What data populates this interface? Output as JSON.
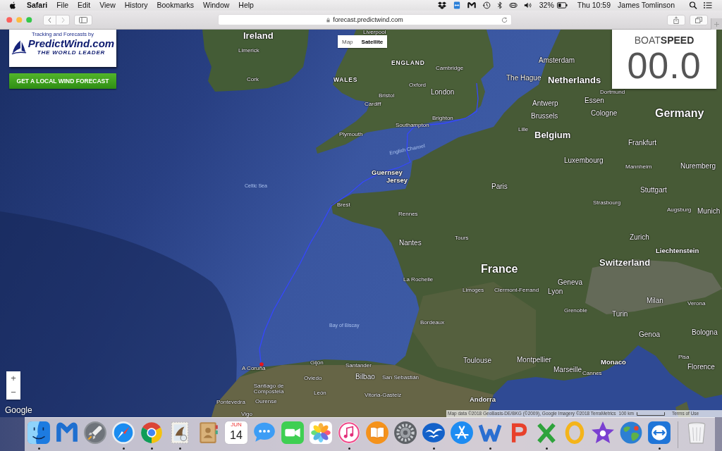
{
  "menu_bar": {
    "app_name": "Safari",
    "menus": [
      "File",
      "Edit",
      "View",
      "History",
      "Bookmarks",
      "Window",
      "Help"
    ],
    "battery": "32%",
    "clock": "Thu 10:59",
    "user": "James Tomlinson"
  },
  "toolbar": {
    "url": "forecast.predictwind.com"
  },
  "map": {
    "logo": {
      "tagline": "Tracking and Forecasts by",
      "name": "PredictWind.com",
      "slogan": "THE WORLD LEADER"
    },
    "forecast_button": "GET A LOCAL WIND FORECAST",
    "map_types": [
      {
        "label": "Map",
        "selected": false
      },
      {
        "label": "Satellite",
        "selected": true
      }
    ],
    "boatspeed": {
      "title": "BOAT**SPEED**",
      "value": "00.0"
    },
    "labels": [
      {
        "text": "Ireland",
        "kind": "country"
      },
      {
        "text": "Liverpool",
        "kind": "city"
      },
      {
        "text": "Limerick",
        "kind": "city"
      },
      {
        "text": "Cork",
        "kind": "city"
      },
      {
        "text": "WALES",
        "kind": "region"
      },
      {
        "text": "ENGLAND",
        "kind": "region"
      },
      {
        "text": "Cambridge",
        "kind": "city"
      },
      {
        "text": "Oxford",
        "kind": "city"
      },
      {
        "text": "London",
        "kind": "major_city"
      },
      {
        "text": "Bristol",
        "kind": "city"
      },
      {
        "text": "Cardiff",
        "kind": "city"
      },
      {
        "text": "Plymouth",
        "kind": "city"
      },
      {
        "text": "Brighton",
        "kind": "city"
      },
      {
        "text": "Southampton",
        "kind": "city"
      },
      {
        "text": "English Channel",
        "kind": "sea"
      },
      {
        "text": "Celtic Sea",
        "kind": "sea"
      },
      {
        "text": "Guernsey",
        "kind": "island"
      },
      {
        "text": "Jersey",
        "kind": "island"
      },
      {
        "text": "Brest",
        "kind": "city"
      },
      {
        "text": "Rennes",
        "kind": "city"
      },
      {
        "text": "Nantes",
        "kind": "major_city"
      },
      {
        "text": "Tours",
        "kind": "city"
      },
      {
        "text": "Paris",
        "kind": "major_city"
      },
      {
        "text": "France",
        "kind": "large_country"
      },
      {
        "text": "La Rochelle",
        "kind": "city"
      },
      {
        "text": "Limoges",
        "kind": "city"
      },
      {
        "text": "Clermont-Ferrand",
        "kind": "city"
      },
      {
        "text": "Lyon",
        "kind": "major_city"
      },
      {
        "text": "Bay of Biscay",
        "kind": "sea"
      },
      {
        "text": "Bordeaux",
        "kind": "city"
      },
      {
        "text": "Amsterdam",
        "kind": "major_city"
      },
      {
        "text": "The Hague",
        "kind": "major_city"
      },
      {
        "text": "Netherlands",
        "kind": "country"
      },
      {
        "text": "Antwerp",
        "kind": "major_city"
      },
      {
        "text": "Essen",
        "kind": "major_city"
      },
      {
        "text": "Dortmund",
        "kind": "city"
      },
      {
        "text": "Brussels",
        "kind": "major_city"
      },
      {
        "text": "Cologne",
        "kind": "major_city"
      },
      {
        "text": "Lille",
        "kind": "city"
      },
      {
        "text": "Belgium",
        "kind": "country"
      },
      {
        "text": "Germany",
        "kind": "large_country"
      },
      {
        "text": "Frankfurt",
        "kind": "major_city"
      },
      {
        "text": "Luxembourg",
        "kind": "major_city"
      },
      {
        "text": "Mannheim",
        "kind": "city"
      },
      {
        "text": "Nuremberg",
        "kind": "major_city"
      },
      {
        "text": "Stuttgart",
        "kind": "major_city"
      },
      {
        "text": "Strasbourg",
        "kind": "city"
      },
      {
        "text": "Augsburg",
        "kind": "city"
      },
      {
        "text": "Munich",
        "kind": "major_city"
      },
      {
        "text": "Zurich",
        "kind": "major_city"
      },
      {
        "text": "Liechtenstein",
        "kind": "minor_country"
      },
      {
        "text": "Switzerland",
        "kind": "country"
      },
      {
        "text": "Geneva",
        "kind": "major_city"
      },
      {
        "text": "Grenoble",
        "kind": "city"
      },
      {
        "text": "Milan",
        "kind": "major_city"
      },
      {
        "text": "Turin",
        "kind": "major_city"
      },
      {
        "text": "Verona",
        "kind": "city"
      },
      {
        "text": "Genoa",
        "kind": "major_city"
      },
      {
        "text": "Bologna",
        "kind": "major_city"
      },
      {
        "text": "Toulouse",
        "kind": "major_city"
      },
      {
        "text": "Montpellier",
        "kind": "major_city"
      },
      {
        "text": "Marseille",
        "kind": "major_city"
      },
      {
        "text": "Monaco",
        "kind": "minor_country"
      },
      {
        "text": "Cannes",
        "kind": "city"
      },
      {
        "text": "Pisa",
        "kind": "city"
      },
      {
        "text": "Florence",
        "kind": "major_city"
      },
      {
        "text": "Andorra",
        "kind": "minor_country"
      },
      {
        "text": "Gijón",
        "kind": "city"
      },
      {
        "text": "Santander",
        "kind": "city"
      },
      {
        "text": "A Coruña",
        "kind": "city"
      },
      {
        "text": "Oviedo",
        "kind": "city"
      },
      {
        "text": "Bilbao",
        "kind": "major_city"
      },
      {
        "text": "San Sebastián",
        "kind": "city"
      },
      {
        "text": "Santiago de Compostela",
        "kind": "city"
      },
      {
        "text": "León",
        "kind": "city"
      },
      {
        "text": "Vitoria-Gasteiz",
        "kind": "city"
      },
      {
        "text": "Pontevedra",
        "kind": "city"
      },
      {
        "text": "Ourense",
        "kind": "city"
      },
      {
        "text": "Vigo",
        "kind": "city"
      }
    ],
    "zoom_controls": [
      "+",
      "−"
    ],
    "google_logo": "Google",
    "attribution": "Map data ©2018 GeoBasis-DE/BKG (©2009), Google Imagery ©2018 TerraMetrics",
    "scale": "100 km",
    "terms": "Terms of Use"
  },
  "dock": [
    {
      "kind": "finder",
      "running": true
    },
    {
      "kind": "malware",
      "running": false
    },
    {
      "kind": "rocket",
      "running": false
    },
    {
      "kind": "compass",
      "running": true
    },
    {
      "kind": "chrome",
      "running": true
    },
    {
      "kind": "stamp",
      "running": true
    },
    {
      "kind": "contacts",
      "running": false
    },
    {
      "kind": "calendar",
      "month": "JUN",
      "day": "14",
      "running": false
    },
    {
      "kind": "messages",
      "running": false
    },
    {
      "kind": "facetime",
      "running": false
    },
    {
      "kind": "photos",
      "running": false
    },
    {
      "kind": "music",
      "running": true
    },
    {
      "kind": "books",
      "running": false
    },
    {
      "kind": "gear",
      "running": false
    },
    {
      "kind": "gulls",
      "running": true
    },
    {
      "kind": "appstore",
      "running": false
    },
    {
      "kind": "w",
      "running": true
    },
    {
      "kind": "p",
      "running": false
    },
    {
      "kind": "x",
      "running": true
    },
    {
      "kind": "o",
      "running": false
    },
    {
      "kind": "star",
      "running": false
    },
    {
      "kind": "globe",
      "running": false
    },
    {
      "kind": "remote",
      "running": true
    },
    {
      "kind": "trash",
      "running": false
    }
  ]
}
